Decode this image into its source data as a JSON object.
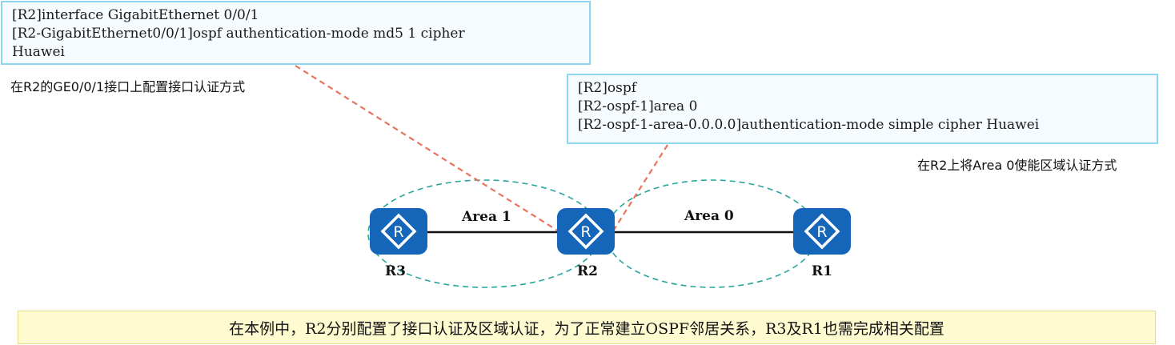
{
  "config_box_interface": {
    "lines": [
      "[R2]interface GigabitEthernet 0/0/1",
      "[R2-GigabitEthernet0/0/1]ospf authentication-mode md5 1 cipher",
      "Huawei"
    ]
  },
  "caption_interface": "在R2的GE0/0/1接口上配置接口认证方式",
  "config_box_area": {
    "lines": [
      "[R2]ospf",
      "[R2-ospf-1]area 0",
      "[R2-ospf-1-area-0.0.0.0]authentication-mode simple cipher Huawei"
    ]
  },
  "caption_area": "在R2上将Area 0使能区域认证方式",
  "areas": [
    {
      "label": "Area 1"
    },
    {
      "label": "Area 0"
    }
  ],
  "routers": [
    {
      "label": "R3",
      "icon": "router-icon"
    },
    {
      "label": "R2",
      "icon": "router-icon"
    },
    {
      "label": "R1",
      "icon": "router-icon"
    }
  ],
  "note": "在本例中，R2分别配置了接口认证及区域认证，为了正常建立OSPF邻居关系，R3及R1也需完成相关配置",
  "colors": {
    "box_border": "#8dd6ef",
    "box_fill": "#f5fbfe",
    "router_fill": "#1565b8",
    "area_ellipse": "#2aa59b",
    "callout_line": "#e8735e",
    "note_fill": "#fdfbcf",
    "link": "#111111"
  }
}
